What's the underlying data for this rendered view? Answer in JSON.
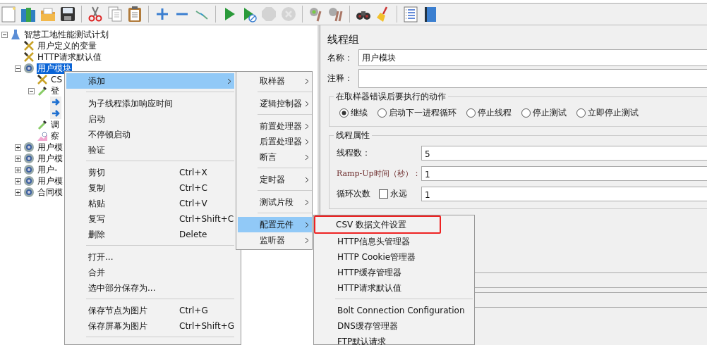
{
  "toolbar": [
    {
      "kind": "new",
      "disabled": false
    },
    {
      "kind": "templates",
      "disabled": false
    },
    {
      "kind": "open",
      "disabled": false
    },
    {
      "kind": "save",
      "disabled": false
    },
    {
      "kind": "separator"
    },
    {
      "kind": "cut",
      "disabled": false
    },
    {
      "kind": "copy",
      "disabled": false
    },
    {
      "kind": "paste",
      "disabled": false
    },
    {
      "kind": "separator"
    },
    {
      "kind": "expand",
      "disabled": false
    },
    {
      "kind": "collapse",
      "disabled": false
    },
    {
      "kind": "toggle",
      "disabled": false
    },
    {
      "kind": "separator"
    },
    {
      "kind": "start",
      "disabled": false
    },
    {
      "kind": "start-no-pause",
      "disabled": false
    },
    {
      "kind": "stop",
      "disabled": true
    },
    {
      "kind": "shutdown",
      "disabled": true
    },
    {
      "kind": "separator"
    },
    {
      "kind": "clear",
      "disabled": false
    },
    {
      "kind": "clear-all",
      "disabled": false
    },
    {
      "kind": "separator"
    },
    {
      "kind": "search",
      "disabled": false
    },
    {
      "kind": "reset-search",
      "disabled": false
    },
    {
      "kind": "separator"
    },
    {
      "kind": "functions",
      "disabled": false
    },
    {
      "kind": "help",
      "disabled": false
    }
  ],
  "tree": [
    {
      "label": "智慧工地性能测试计划",
      "kind": "plan",
      "expanded": true,
      "selected": false,
      "children": [
        {
          "label": "用户定义的变量",
          "kind": "config",
          "selected": false
        },
        {
          "label": "HTTP请求默认值",
          "kind": "config",
          "selected": false
        },
        {
          "label": "用户模块",
          "kind": "thread-group",
          "expanded": true,
          "selected": true,
          "children": [
            {
              "label": "CS",
              "kind": "config",
              "selected": false
            },
            {
              "label": "登",
              "kind": "controller",
              "expanded": true,
              "selected": false,
              "children": [
                {
                  "kind": "sampler",
                  "selected": false
                },
                {
                  "kind": "sampler",
                  "selected": false
                }
              ]
            },
            {
              "label": "调",
              "kind": "debug",
              "selected": false
            },
            {
              "label": "察",
              "kind": "listener",
              "selected": false
            }
          ]
        },
        {
          "label": "用户模",
          "kind": "thread-group",
          "expanded": false,
          "selected": false
        },
        {
          "label": "用户模",
          "kind": "thread-group",
          "expanded": false,
          "selected": false
        },
        {
          "label": "用户-",
          "kind": "thread-group",
          "expanded": false,
          "selected": false
        },
        {
          "label": "用户模",
          "kind": "thread-group",
          "expanded": false,
          "selected": false
        },
        {
          "label": "合同模",
          "kind": "thread-group",
          "expanded": false,
          "selected": false
        }
      ]
    }
  ],
  "editor": {
    "title": "线程组",
    "name_label": "名称：",
    "name_value": "用户模块",
    "comment_label": "注释：",
    "error_action": {
      "legend": "在取样器错误后要执行的动作",
      "options": [
        {
          "label": "继续",
          "selected": true
        },
        {
          "label": "启动下一进程循环",
          "selected": false
        },
        {
          "label": "停止线程",
          "selected": false
        },
        {
          "label": "停止测试",
          "selected": false
        },
        {
          "label": "立即停止测试",
          "selected": false
        }
      ]
    },
    "thread_properties": {
      "legend": "线程属性",
      "threads_label": "线程数：",
      "threads_value": "5",
      "rampup_label": "Ramp-Up时间（秒）：",
      "rampup_value": "1",
      "loop_label": "循环次数",
      "forever_label": "永远",
      "forever_checked": false,
      "loop_value": "1"
    }
  },
  "context_menu": {
    "items": [
      {
        "kind": "item",
        "label": "添加",
        "submenu": true,
        "selected": true
      },
      {
        "kind": "separator"
      },
      {
        "kind": "item",
        "label": "为子线程添加响应时间",
        "selected": false
      },
      {
        "kind": "item",
        "label": "启动",
        "selected": false
      },
      {
        "kind": "item",
        "label": "不停顿启动",
        "selected": false
      },
      {
        "kind": "item",
        "label": "验证",
        "selected": false
      },
      {
        "kind": "separator"
      },
      {
        "kind": "item",
        "label": "剪切",
        "shortcut": "Ctrl+X",
        "selected": false
      },
      {
        "kind": "item",
        "label": "复制",
        "shortcut": "Ctrl+C",
        "selected": false
      },
      {
        "kind": "item",
        "label": "粘贴",
        "shortcut": "Ctrl+V",
        "selected": false
      },
      {
        "kind": "item",
        "label": "复写",
        "shortcut": "Ctrl+Shift+C",
        "selected": false
      },
      {
        "kind": "item",
        "label": "删除",
        "shortcut": "Delete",
        "selected": false
      },
      {
        "kind": "separator"
      },
      {
        "kind": "item",
        "label": "打开...",
        "selected": false
      },
      {
        "kind": "item",
        "label": "合并",
        "selected": false
      },
      {
        "kind": "item",
        "label": "选中部分保存为...",
        "selected": false
      },
      {
        "kind": "separator"
      },
      {
        "kind": "item",
        "label": "保存节点为图片",
        "shortcut": "Ctrl+G",
        "selected": false
      },
      {
        "kind": "item",
        "label": "保存屏幕为图片",
        "shortcut": "Ctrl+Shift+G",
        "selected": false
      },
      {
        "kind": "separator"
      }
    ]
  },
  "add_submenu": {
    "items": [
      {
        "kind": "item",
        "label": "取样器",
        "submenu": true,
        "selected": false
      },
      {
        "kind": "separator"
      },
      {
        "kind": "item",
        "label": "逻辑控制器",
        "submenu": true,
        "selected": false
      },
      {
        "kind": "separator"
      },
      {
        "kind": "item",
        "label": "前置处理器",
        "submenu": true,
        "selected": false
      },
      {
        "kind": "item",
        "label": "后置处理器",
        "submenu": true,
        "selected": false
      },
      {
        "kind": "item",
        "label": "断言",
        "submenu": true,
        "selected": false
      },
      {
        "kind": "separator"
      },
      {
        "kind": "item",
        "label": "定时器",
        "submenu": true,
        "selected": false
      },
      {
        "kind": "separator"
      },
      {
        "kind": "item",
        "label": "测试片段",
        "submenu": true,
        "selected": false
      },
      {
        "kind": "separator"
      },
      {
        "kind": "item",
        "label": "配置元件",
        "submenu": true,
        "selected": true
      },
      {
        "kind": "item",
        "label": "监听器",
        "submenu": true,
        "selected": false
      }
    ]
  },
  "config_submenu": {
    "items": [
      {
        "kind": "item",
        "label": "CSV 数据文件设置",
        "annotated": true,
        "selected": false
      },
      {
        "kind": "item",
        "label": "HTTP信息头管理器",
        "annotated": false,
        "selected": false
      },
      {
        "kind": "item",
        "label": "HTTP Cookie管理器",
        "annotated": false,
        "selected": false
      },
      {
        "kind": "item",
        "label": "HTTP缓存管理器",
        "annotated": false,
        "selected": false
      },
      {
        "kind": "item",
        "label": "HTTP请求默认值",
        "annotated": false,
        "selected": false
      },
      {
        "kind": "separator"
      },
      {
        "kind": "item",
        "label": "Bolt Connection Configuration",
        "annotated": false,
        "selected": false
      },
      {
        "kind": "item",
        "label": "DNS缓存管理器",
        "annotated": false,
        "selected": false
      },
      {
        "kind": "item",
        "label": "FTP默认请求",
        "annotated": false,
        "selected": false
      }
    ]
  }
}
